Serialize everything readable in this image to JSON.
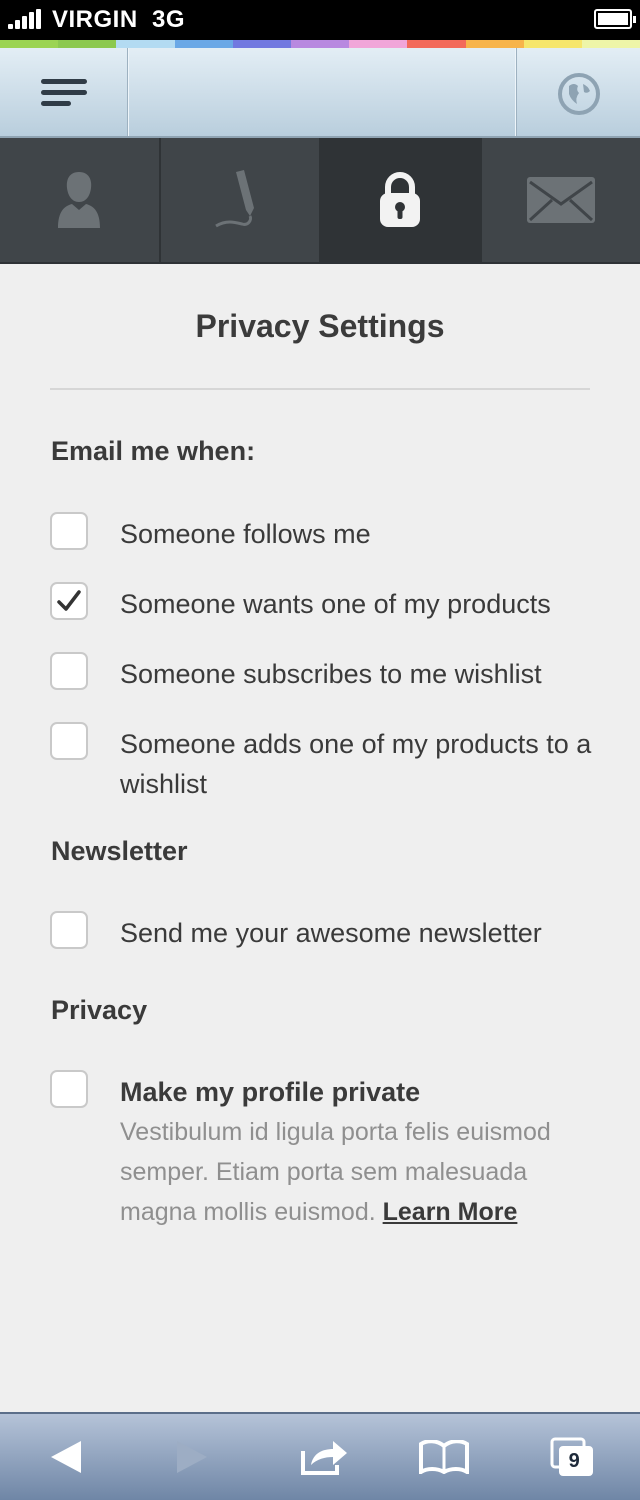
{
  "status_bar": {
    "carrier": "VIRGIN",
    "network": "3G"
  },
  "rainbow_colors": [
    "#9bd452",
    "#8cc94f",
    "#b3dbf2",
    "#6aa8e6",
    "#7179e0",
    "#b889e0",
    "#f1a6d9",
    "#f36a5a",
    "#f7b44a",
    "#f6e66c",
    "#eef5a8"
  ],
  "header": {
    "menu_icon": "hamburger-menu-icon",
    "globe_icon": "globe-icon"
  },
  "tabs": [
    {
      "icon": "user-icon",
      "active": false
    },
    {
      "icon": "pen-icon",
      "active": false
    },
    {
      "icon": "lock-icon",
      "active": true
    },
    {
      "icon": "envelope-icon",
      "active": false
    }
  ],
  "page": {
    "title": "Privacy Settings",
    "email_section": {
      "heading": "Email me when:",
      "options": [
        {
          "label": "Someone follows me",
          "checked": false
        },
        {
          "label": "Someone wants one of my products",
          "checked": true
        },
        {
          "label": "Someone subscribes to me wishlist",
          "checked": false
        },
        {
          "label": "Someone adds one of my products to a wishlist",
          "checked": false
        }
      ]
    },
    "newsletter_section": {
      "heading": "Newsletter",
      "options": [
        {
          "label": "Send me your awesome newsletter",
          "checked": false
        }
      ]
    },
    "privacy_section": {
      "heading": "Privacy",
      "option": {
        "label": "Make my profile private",
        "checked": false,
        "description": "Vestibulum id ligula porta felis euismod semper. Etiam porta sem malesuada magna mollis euismod.",
        "link": "Learn More"
      }
    }
  },
  "toolbar": {
    "tab_count": "9",
    "back_icon": "back-arrow-icon",
    "forward_icon": "forward-arrow-icon",
    "share_icon": "share-icon",
    "bookmarks_icon": "bookmarks-icon",
    "tabs_icon": "tabs-icon"
  },
  "colors": {
    "tab_bg": "#404549",
    "tab_active": "#2f3336",
    "text": "#3a3a3a",
    "muted": "#8f8f8f"
  }
}
